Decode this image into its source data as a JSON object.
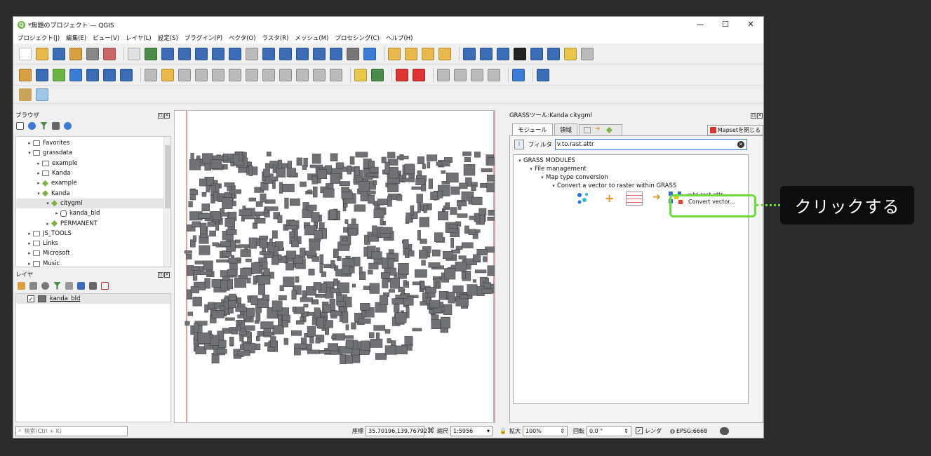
{
  "window": {
    "title": "*無題のプロジェクト — QGIS",
    "controls": [
      "—",
      "☐",
      "✕"
    ]
  },
  "menu": [
    "プロジェクト(J)",
    "編集(E)",
    "ビュー(V)",
    "レイヤ(L)",
    "設定(S)",
    "プラグイン(P)",
    "ベクタ(O)",
    "ラスタ(R)",
    "メッシュ(M)",
    "プロセシング(C)",
    "ヘルプ(H)"
  ],
  "browser": {
    "title": "ブラウザ",
    "items": [
      {
        "label": "Favorites",
        "indent": 0,
        "arrow": "▸",
        "icon": "folder"
      },
      {
        "label": "grassdata",
        "indent": 0,
        "arrow": "▾",
        "icon": "folder"
      },
      {
        "label": "example",
        "indent": 1,
        "arrow": "▸",
        "icon": "folder"
      },
      {
        "label": "Kanda",
        "indent": 1,
        "arrow": "▸",
        "icon": "folder"
      },
      {
        "label": "example",
        "indent": 1,
        "arrow": "▸",
        "icon": "grass"
      },
      {
        "label": "Kanda",
        "indent": 1,
        "arrow": "▾",
        "icon": "grass"
      },
      {
        "label": "citygml",
        "indent": 2,
        "arrow": "▾",
        "icon": "grass"
      },
      {
        "label": "kanda_bld",
        "indent": 3,
        "arrow": "▸",
        "icon": "db"
      },
      {
        "label": "PERMANENT",
        "indent": 2,
        "arrow": "▸",
        "icon": "grass"
      },
      {
        "label": "JS_TOOLS",
        "indent": 0,
        "arrow": "▸",
        "icon": "folder"
      },
      {
        "label": "Links",
        "indent": 0,
        "arrow": "▸",
        "icon": "folder"
      },
      {
        "label": "Microsoft",
        "indent": 0,
        "arrow": "▸",
        "icon": "folder"
      },
      {
        "label": "Music",
        "indent": 0,
        "arrow": "▸",
        "icon": "folder"
      }
    ]
  },
  "layers": {
    "title": "レイヤ",
    "items": [
      {
        "label": "kanda_bld",
        "checked": "✓"
      }
    ]
  },
  "grass": {
    "title": "GRASSツール:Kanda citygml",
    "tabs": [
      "モジュール",
      "領域"
    ],
    "close_mapset": "Mapsetを閉じる",
    "filter_label": "フィルタ",
    "filter_value": "v.to.rast.attr",
    "tree": [
      {
        "label": "GRASS MODULES",
        "indent": 0
      },
      {
        "label": "File management",
        "indent": 1
      },
      {
        "label": "Map type conversion",
        "indent": 2
      },
      {
        "label": "Convert a vector to raster within GRASS",
        "indent": 3
      }
    ],
    "module_name": "v.to.rast.attr",
    "module_desc": "Convert vector..."
  },
  "statusbar": {
    "search_placeholder": "検索(Ctrl + K)",
    "coord_label": "座標",
    "coord_value": "35.70196,139.76792",
    "scale_label": "縮尺",
    "scale_value": "1:5956",
    "magnify_label": "拡大",
    "magnify_value": "100%",
    "rotation_label": "回転",
    "rotation_value": "0.0 °",
    "render_label": "レンダ",
    "crs": "EPSG:6668"
  },
  "callout": "クリックする",
  "colors": {
    "highlight": "#6bdc3c",
    "building": "#6f7175",
    "map_border": "#d23c3c"
  }
}
